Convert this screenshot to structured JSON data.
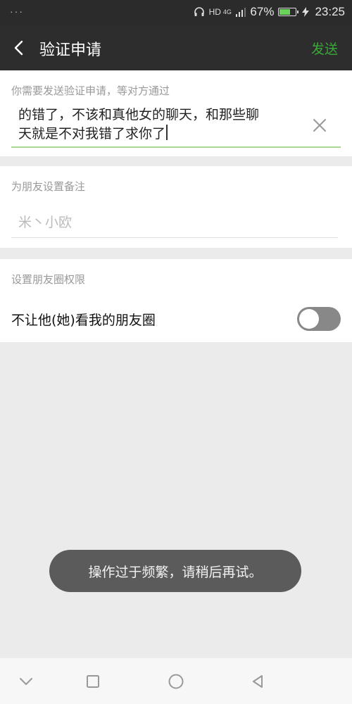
{
  "status_bar": {
    "left_indicator": "···",
    "hd_label": "HD",
    "network_label": "4G",
    "battery_percent_label": "67%",
    "battery_level": 0.67,
    "time": "23:25"
  },
  "header": {
    "title": "验证申请",
    "send_label": "发送"
  },
  "verification": {
    "hint": "你需要发送验证申请，等对方通过",
    "message_visible_partial": "的错了，不该和真他女的聊天，和那些聊",
    "message_last_line": "天就是不对我错了求你了"
  },
  "remark": {
    "hint": "为朋友设置备注",
    "placeholder": "米丶小欧"
  },
  "moments": {
    "hint": "设置朋友圈权限",
    "toggle_label": "不让他(她)看我的朋友圈",
    "toggle_on": false
  },
  "toast": {
    "text": "操作过于频繁，请稍后再试。"
  },
  "colors": {
    "header_bg": "#2d2d2d",
    "accent_green": "#3aa83a",
    "field_underline": "#a6d88e",
    "toast_bg": "#5b5b5b"
  }
}
